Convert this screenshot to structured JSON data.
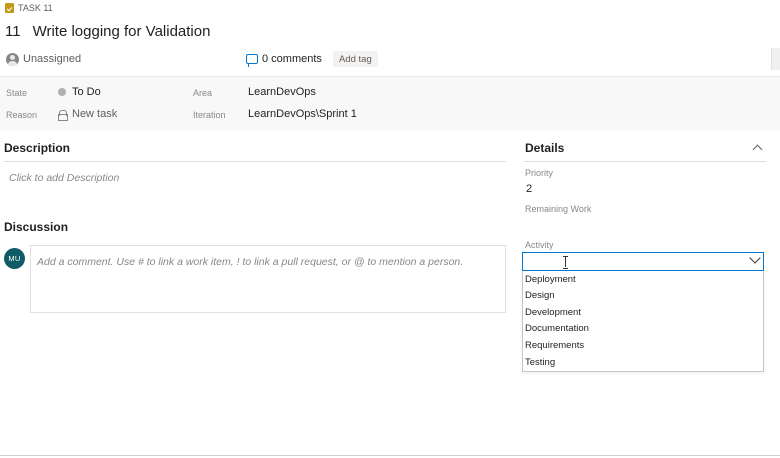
{
  "header": {
    "work_item_type": "TASK 11",
    "id": "11",
    "title": "Write logging for Validation",
    "assignee": "Unassigned",
    "comments": "0 comments",
    "add_tag": "Add tag"
  },
  "fields": {
    "state_label": "State",
    "state_value": "To Do",
    "reason_label": "Reason",
    "reason_value": "New task",
    "area_label": "Area",
    "area_value": "LearnDevOps",
    "iteration_label": "Iteration",
    "iteration_value": "LearnDevOps\\Sprint 1"
  },
  "description": {
    "title": "Description",
    "placeholder": "Click to add Description"
  },
  "discussion": {
    "title": "Discussion",
    "avatar_initials": "MU",
    "placeholder": "Add a comment. Use # to link a work item, ! to link a pull request, or @ to mention a person."
  },
  "details": {
    "title": "Details",
    "priority_label": "Priority",
    "priority_value": "2",
    "remaining_work_label": "Remaining Work",
    "activity_label": "Activity",
    "activity_value": "",
    "activity_options": [
      "Deployment",
      "Design",
      "Development",
      "Documentation",
      "Requirements",
      "Testing"
    ]
  },
  "colors": {
    "accent": "#0078d4",
    "avatar_bg": "#0f5b66",
    "state_dot": "#b3b0ad",
    "task_icon": "#c49a1a"
  },
  "icons": [
    "task-icon",
    "person-icon",
    "comment-icon",
    "lock-icon",
    "chevron-up-icon",
    "chevron-down-icon",
    "text-cursor-icon"
  ]
}
